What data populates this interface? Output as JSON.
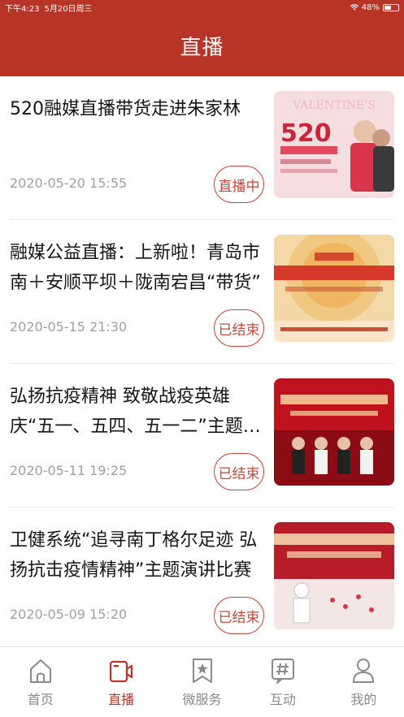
{
  "status_bar": {
    "time": "下午4:23",
    "date": "5月20日周三",
    "battery": "48%",
    "battery_level": 0.48
  },
  "header": {
    "title": "直播"
  },
  "feed": [
    {
      "title": "520融媒直播带货走进朱家林",
      "date": "2020-05-20 15:55",
      "status": "直播中",
      "thumb_caption": "520 浪漫价给你 “甜”你幸福 下单不“愁”"
    },
    {
      "title": "融媒公益直播：上新啦！青岛市南＋安顺平坝＋陇南宕昌“带货”",
      "date": "2020-05-15 21:30",
      "status": "已结束",
      "thumb_caption": "扶贫攻坚 山东融媒公益直播联盟"
    },
    {
      "title": "弘扬抗疫精神 致敬战疫英雄 庆“五一、五四、五一二”主题演讲",
      "date": "2020-05-11 19:25",
      "status": "已结束",
      "thumb_caption": "弘扬抗疫精神 致敬战疫英雄"
    },
    {
      "title": "卫健系统“追寻南丁格尔足迹 弘扬抗击疫情精神”主题演讲比赛",
      "date": "2020-05-09 15:20",
      "status": "已结束",
      "thumb_caption": "追寻南丁格尔足迹 弘扬抗击疫情精神"
    }
  ],
  "tabs": [
    {
      "label": "首页",
      "icon": "home-icon",
      "active": false
    },
    {
      "label": "直播",
      "icon": "video-icon",
      "active": true
    },
    {
      "label": "微服务",
      "icon": "bookmark-star-icon",
      "active": false
    },
    {
      "label": "互动",
      "icon": "hashtag-icon",
      "active": false
    },
    {
      "label": "我的",
      "icon": "person-icon",
      "active": false
    }
  ],
  "colors": {
    "brand": "#b73427",
    "accent_text": "#c4483d",
    "muted": "#a0a0a0",
    "tab_inactive": "#8a8a8a"
  }
}
